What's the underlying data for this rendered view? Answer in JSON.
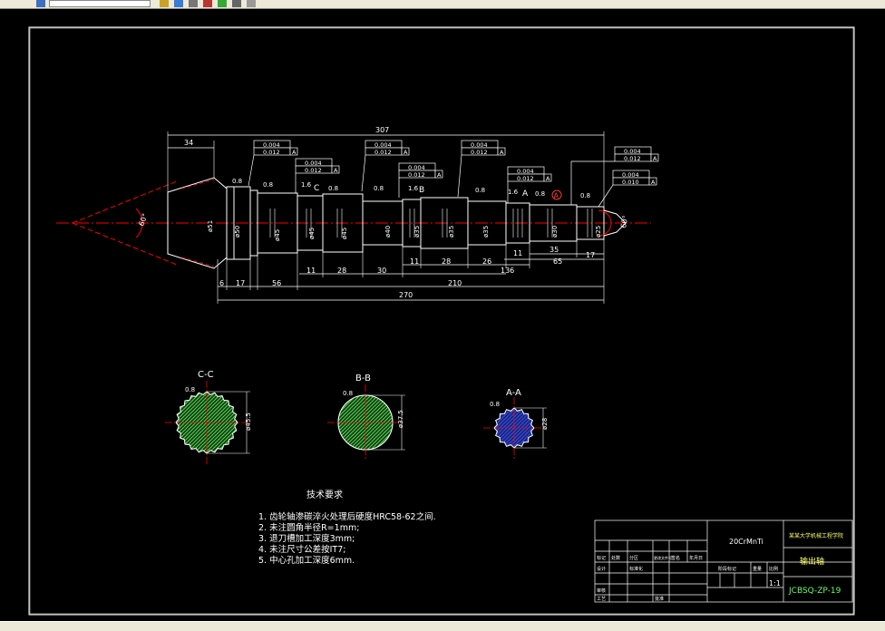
{
  "colors": {
    "background": "#000000",
    "frame": "#ffffff",
    "center_line": "#ff0000",
    "shaft": "#ffffff",
    "hatch_cc": "#5fd35f",
    "hatch_bb": "#5fd35f",
    "hatch_aa": "#3a50d8",
    "title_text": "#ffff66",
    "drawing_no_text": "#66ff66"
  },
  "icons": [
    "app-icon",
    "open-icon",
    "save-icon",
    "print-icon",
    "undo-icon",
    "redo-icon",
    "pan-icon",
    "zoom-icon"
  ],
  "dimensions": {
    "overall_top": "307",
    "left_cone": "34",
    "bottom_total": "270",
    "d6": "6",
    "d17a": "17",
    "d56": "56",
    "d11a": "11",
    "d28a": "28",
    "d30": "30",
    "d11b": "11",
    "d28b": "28",
    "d26": "26",
    "d136": "136",
    "d11c": "11",
    "d210": "210",
    "d35": "35",
    "d65": "65",
    "d17b": "17"
  },
  "diameters": [
    "ø51",
    "ø50",
    "ø45",
    "ø45",
    "ø45",
    "ø40",
    "ø35",
    "ø35",
    "ø35",
    "ø30",
    "ø25"
  ],
  "angles": {
    "left": "60°",
    "right": "60°"
  },
  "surface": [
    "0.8",
    "0.8",
    "1.6",
    "0.8",
    "0.8",
    "1.6",
    "0.8",
    "1.6",
    "0.8",
    "0.8"
  ],
  "tolerance_frames": [
    {
      "a": "0.004",
      "b": "0.012",
      "ref": "A"
    },
    {
      "a": "0.004",
      "b": "0.012",
      "ref": "A"
    },
    {
      "a": "0.004",
      "b": "0.012",
      "ref": "A"
    },
    {
      "a": "0.004",
      "b": "0.012",
      "ref": "A"
    },
    {
      "a": "0.004",
      "b": "0.012",
      "ref": "A"
    },
    {
      "a": "0.004",
      "b": "0.012",
      "ref": "A"
    },
    {
      "a": "0.004",
      "b": "0.010",
      "ref": "A"
    }
  ],
  "section_markers": {
    "c": "C",
    "b": "B",
    "a": "A",
    "datum": "A"
  },
  "sections": [
    {
      "label": "C-C",
      "roughness": "0.8",
      "dim": "ø45.5"
    },
    {
      "label": "B-B",
      "roughness": "0.8",
      "dim": "ø37.5"
    },
    {
      "label": "A-A",
      "roughness": "0.8",
      "dim": "ø28"
    }
  ],
  "notes": {
    "title": "技术要求",
    "items": [
      "1. 齿轮轴渗碳淬火处理后硬度HRC58-62之间.",
      "2. 未注圆角半径R=1mm;",
      "3. 退刀槽加工深度3mm;",
      "4. 未注尺寸公差按IT7;",
      "5. 中心孔加工深度6mm."
    ]
  },
  "title_block": {
    "material": "20CrMnTi",
    "school": "某某大学机械工程学院",
    "part_name": "输出轴",
    "drawing_no": "JCBSQ-ZP-19",
    "scale": "1:1",
    "small_labels": [
      "标记",
      "处数",
      "分区",
      "更改文件号",
      "签名",
      "年月日"
    ],
    "row_labels": [
      "设计",
      "标准化",
      "审核",
      "工艺",
      "批准"
    ],
    "stage_labels": [
      "阶段标记",
      "重量",
      "比例"
    ]
  }
}
